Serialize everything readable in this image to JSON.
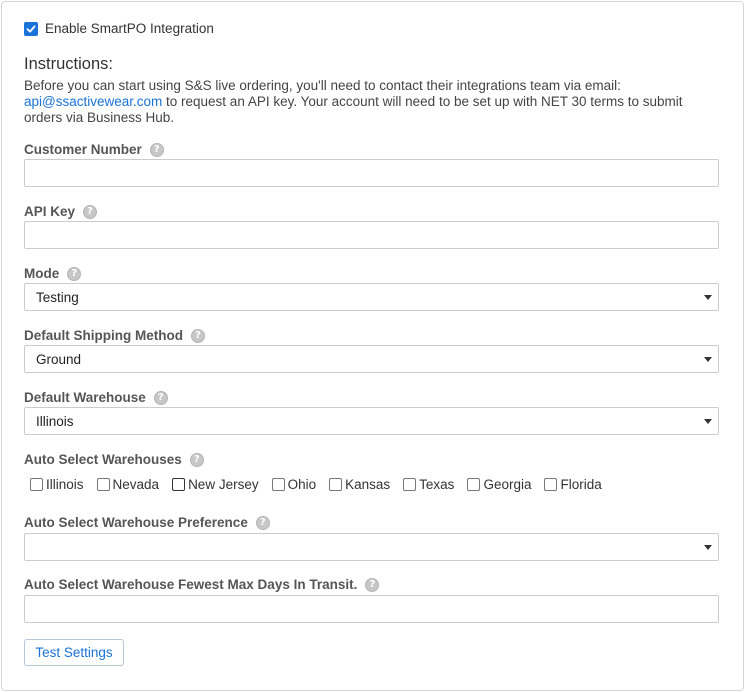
{
  "enable": {
    "label": "Enable SmartPO Integration",
    "checked": true
  },
  "instructions": {
    "title": "Instructions:",
    "text_before": "Before you can start using S&S live ordering, you'll need to contact their integrations team via email: ",
    "email": "api@ssactivewear.com",
    "text_after": " to request an API key. Your account will need to be set up with NET 30 terms to submit orders via Business Hub."
  },
  "fields": {
    "customer_number": {
      "label": "Customer Number",
      "value": ""
    },
    "api_key": {
      "label": "API Key",
      "value": ""
    },
    "mode": {
      "label": "Mode",
      "value": "Testing"
    },
    "default_shipping_method": {
      "label": "Default Shipping Method",
      "value": "Ground"
    },
    "default_warehouse": {
      "label": "Default Warehouse",
      "value": "Illinois"
    },
    "auto_select_warehouses": {
      "label": "Auto Select Warehouses",
      "options": [
        "Illinois",
        "Nevada",
        "New Jersey",
        "Ohio",
        "Kansas",
        "Texas",
        "Georgia",
        "Florida"
      ]
    },
    "auto_select_preference": {
      "label": "Auto Select Warehouse Preference",
      "value": ""
    },
    "fewest_max_days": {
      "label": "Auto Select Warehouse Fewest Max Days In Transit.",
      "value": ""
    }
  },
  "help_icon_glyph": "?",
  "test_button": {
    "label": "Test Settings"
  },
  "colors": {
    "accent": "#1a73d9",
    "border": "#cccccc",
    "label": "#555555"
  }
}
